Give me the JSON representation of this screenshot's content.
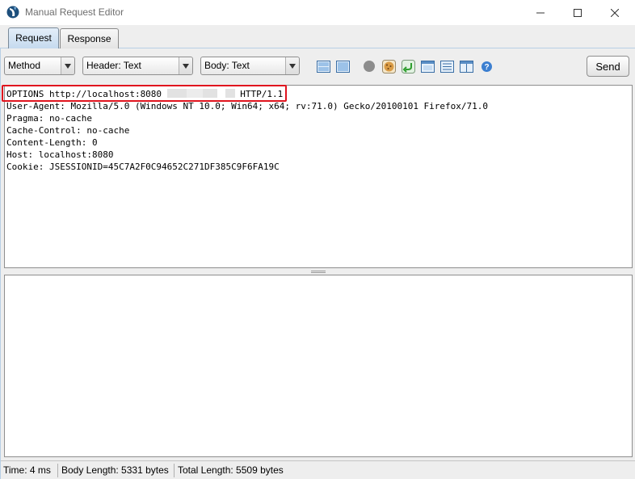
{
  "window": {
    "title": "Manual Request Editor"
  },
  "tabs": [
    {
      "label": "Request",
      "active": true
    },
    {
      "label": "Response",
      "active": false
    }
  ],
  "toolbar": {
    "method_combo": "Method",
    "header_combo": "Header: Text",
    "body_combo": "Body: Text",
    "send_label": "Send",
    "icons": [
      "split-horizontal-icon",
      "split-vertical-icon",
      "circle-icon",
      "cookie-icon",
      "follow-redirect-icon",
      "window-icon",
      "list-view-icon",
      "table-view-icon",
      "help-icon"
    ]
  },
  "request": {
    "request_line_before": "OPTIONS http://localhost:8080",
    "request_line_after": " HTTP/1.1",
    "headers": [
      "User-Agent: Mozilla/5.0 (Windows NT 10.0; Win64; x64; rv:71.0) Gecko/20100101 Firefox/71.0",
      "Pragma: no-cache",
      "Cache-Control: no-cache",
      "Content-Length: 0",
      "Host: localhost:8080",
      "Cookie: JSESSIONID=45C7A2F0C94652C271DF385C9F6FA19C"
    ]
  },
  "status": {
    "time": "Time: 4 ms",
    "body_length": "Body Length: 5331 bytes",
    "total_length": "Total Length: 5509 bytes"
  },
  "colors": {
    "highlight": "#e0141e",
    "tab_active": "#c4d9ee"
  }
}
